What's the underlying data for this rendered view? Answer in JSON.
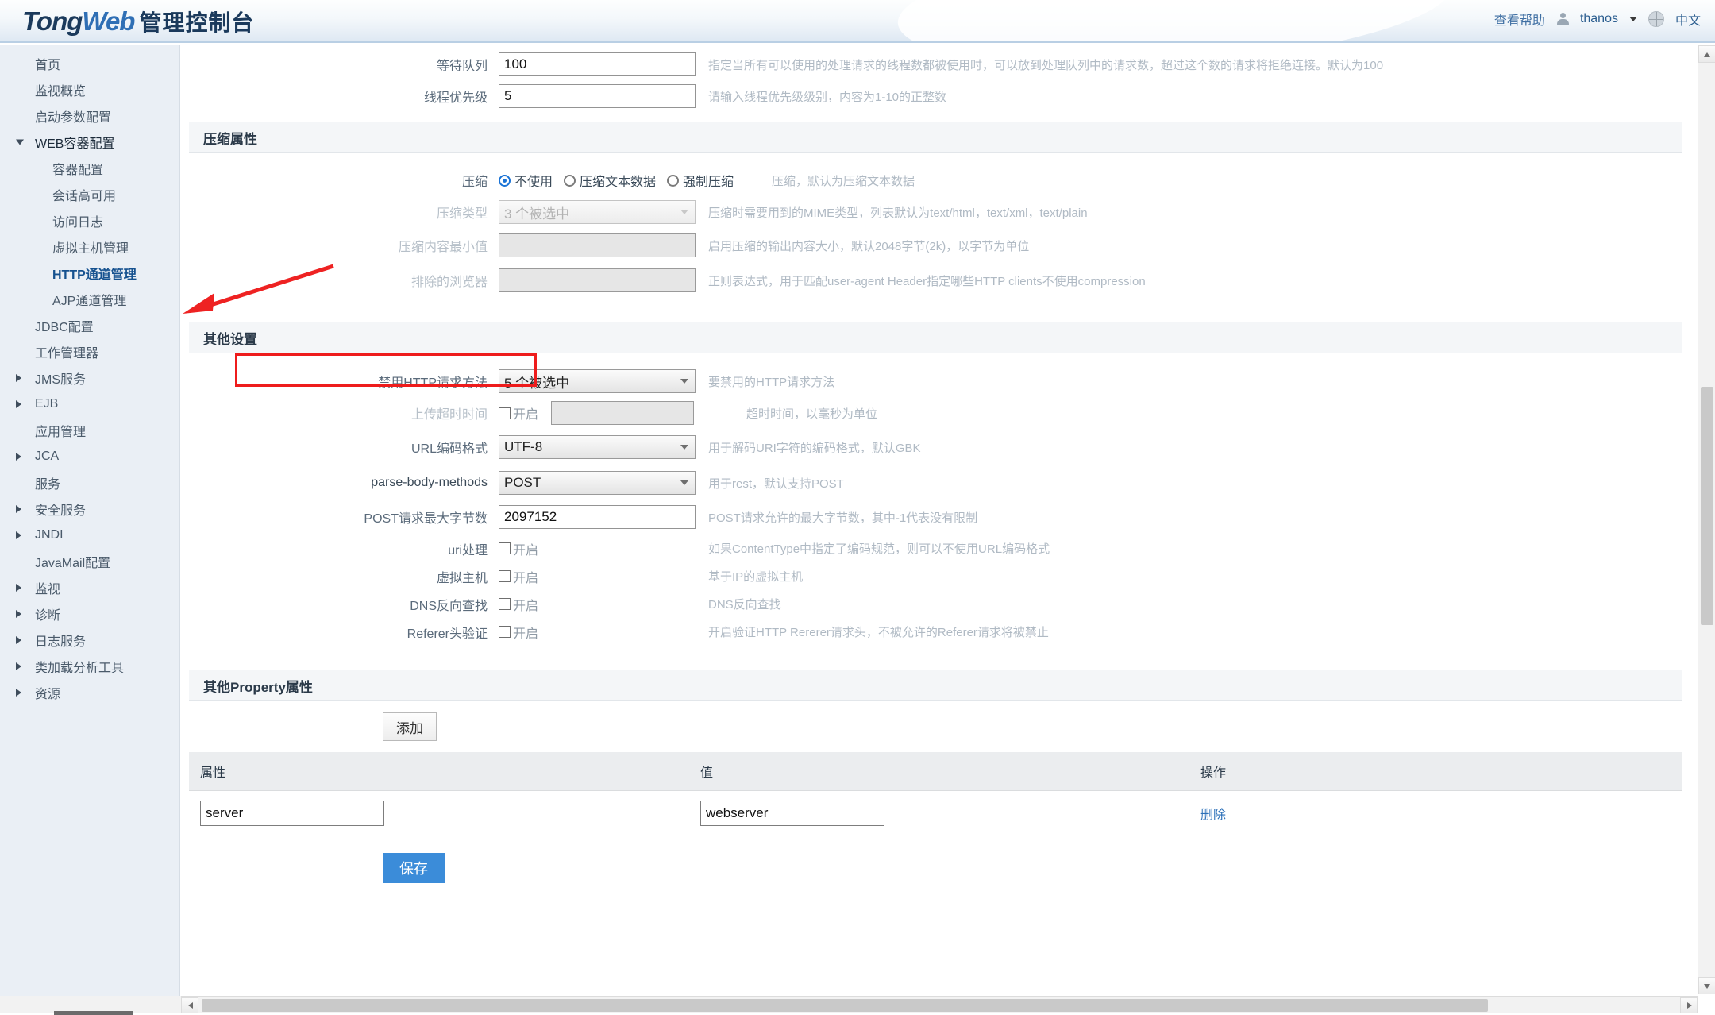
{
  "header": {
    "logo_tong": "Tong",
    "logo_web": "Web",
    "logo_cn": "管理控制台",
    "help_label": "查看帮助",
    "user_name": "thanos",
    "lang_label": "中文"
  },
  "sidebar": {
    "items": [
      {
        "label": "首页",
        "level": 1,
        "arrow": "none",
        "active": false
      },
      {
        "label": "监视概览",
        "level": 1,
        "arrow": "none",
        "active": false
      },
      {
        "label": "启动参数配置",
        "level": 1,
        "arrow": "none",
        "active": false
      },
      {
        "label": "WEB容器配置",
        "level": 1,
        "arrow": "open",
        "active": false,
        "parent": true
      },
      {
        "label": "容器配置",
        "level": 2,
        "arrow": "none",
        "active": false
      },
      {
        "label": "会话高可用",
        "level": 2,
        "arrow": "none",
        "active": false
      },
      {
        "label": "访问日志",
        "level": 2,
        "arrow": "none",
        "active": false
      },
      {
        "label": "虚拟主机管理",
        "level": 2,
        "arrow": "none",
        "active": false
      },
      {
        "label": "HTTP通道管理",
        "level": 2,
        "arrow": "none",
        "active": true
      },
      {
        "label": "AJP通道管理",
        "level": 2,
        "arrow": "none",
        "active": false
      },
      {
        "label": "JDBC配置",
        "level": 1,
        "arrow": "none",
        "active": false
      },
      {
        "label": "工作管理器",
        "level": 1,
        "arrow": "none",
        "active": false
      },
      {
        "label": "JMS服务",
        "level": 1,
        "arrow": "closed",
        "active": false
      },
      {
        "label": "EJB",
        "level": 1,
        "arrow": "closed",
        "active": false
      },
      {
        "label": "应用管理",
        "level": 1,
        "arrow": "none",
        "active": false
      },
      {
        "label": "JCA",
        "level": 1,
        "arrow": "closed",
        "active": false
      },
      {
        "label": "服务",
        "level": 1,
        "arrow": "none",
        "active": false
      },
      {
        "label": "安全服务",
        "level": 1,
        "arrow": "closed",
        "active": false
      },
      {
        "label": "JNDI",
        "level": 1,
        "arrow": "closed",
        "active": false
      },
      {
        "label": "JavaMail配置",
        "level": 1,
        "arrow": "none",
        "active": false
      },
      {
        "label": "监视",
        "level": 1,
        "arrow": "closed",
        "active": false
      },
      {
        "label": "诊断",
        "level": 1,
        "arrow": "closed",
        "active": false
      },
      {
        "label": "日志服务",
        "level": 1,
        "arrow": "closed",
        "active": false
      },
      {
        "label": "类加载分析工具",
        "level": 1,
        "arrow": "closed",
        "active": false
      },
      {
        "label": "资源",
        "level": 1,
        "arrow": "closed",
        "active": false
      }
    ]
  },
  "form": {
    "wait_queue": {
      "label": "等待队列",
      "value": "100",
      "hint": "指定当所有可以使用的处理请求的线程数都被使用时，可以放到处理队列中的请求数，超过这个数的请求将拒绝连接。默认为100"
    },
    "thread_priority": {
      "label": "线程优先级",
      "value": "5",
      "hint": "请输入线程优先级级别，内容为1-10的正整数"
    }
  },
  "compression_section": {
    "title": "压缩属性",
    "compression": {
      "label": "压缩",
      "options": [
        "不使用",
        "压缩文本数据",
        "强制压缩"
      ],
      "selected_index": 0,
      "hint": "压缩，默认为压缩文本数据"
    },
    "compression_type": {
      "label": "压缩类型",
      "value": "3 个被选中",
      "hint": "压缩时需要用到的MIME类型，列表默认为text/html，text/xml，text/plain"
    },
    "min_content": {
      "label": "压缩内容最小值",
      "value": "",
      "hint": "启用压缩的输出内容大小，默认2048字节(2k)，以字节为单位"
    },
    "excluded_browsers": {
      "label": "排除的浏览器",
      "value": "",
      "hint": "正则表达式，用于匹配user-agent Header指定哪些HTTP clients不使用compression"
    }
  },
  "other_section": {
    "title": "其他设置",
    "disabled_methods": {
      "label": "禁用HTTP请求方法",
      "value": "5 个被选中",
      "hint": "要禁用的HTTP请求方法"
    },
    "upload_timeout": {
      "label": "上传超时时间",
      "checkbox_label": "开启",
      "checked": false,
      "value": "",
      "hint": "超时时间，以毫秒为单位"
    },
    "url_encoding": {
      "label": "URL编码格式",
      "value": "UTF-8",
      "hint": "用于解码URI字符的编码格式，默认GBK",
      "highlight_color": "#ee1c1c"
    },
    "parse_body_methods": {
      "label": "parse-body-methods",
      "value": "POST",
      "hint": "用于rest，默认支持POST"
    },
    "post_max_bytes": {
      "label": "POST请求最大字节数",
      "value": "2097152",
      "hint": "POST请求允许的最大字节数，其中-1代表没有限制"
    },
    "uri_handling": {
      "label": "uri处理",
      "checkbox_label": "开启",
      "checked": false,
      "hint": "如果ContentType中指定了编码规范，则可以不使用URL编码格式"
    },
    "virtual_host": {
      "label": "虚拟主机",
      "checkbox_label": "开启",
      "checked": false,
      "hint": "基于IP的虚拟主机"
    },
    "dns_lookup": {
      "label": "DNS反向查找",
      "checkbox_label": "开启",
      "checked": false,
      "hint": "DNS反向查找"
    },
    "referer_check": {
      "label": "Referer头验证",
      "checkbox_label": "开启",
      "checked": false,
      "hint": "开启验证HTTP Rererer请求头，不被允许的Referer请求将被禁止"
    }
  },
  "property_section": {
    "title": "其他Property属性",
    "add_label": "添加",
    "columns": [
      "属性",
      "值",
      "操作"
    ],
    "rows": [
      {
        "name": "server",
        "value": "webserver",
        "action": "删除"
      }
    ],
    "save_label": "保存"
  }
}
